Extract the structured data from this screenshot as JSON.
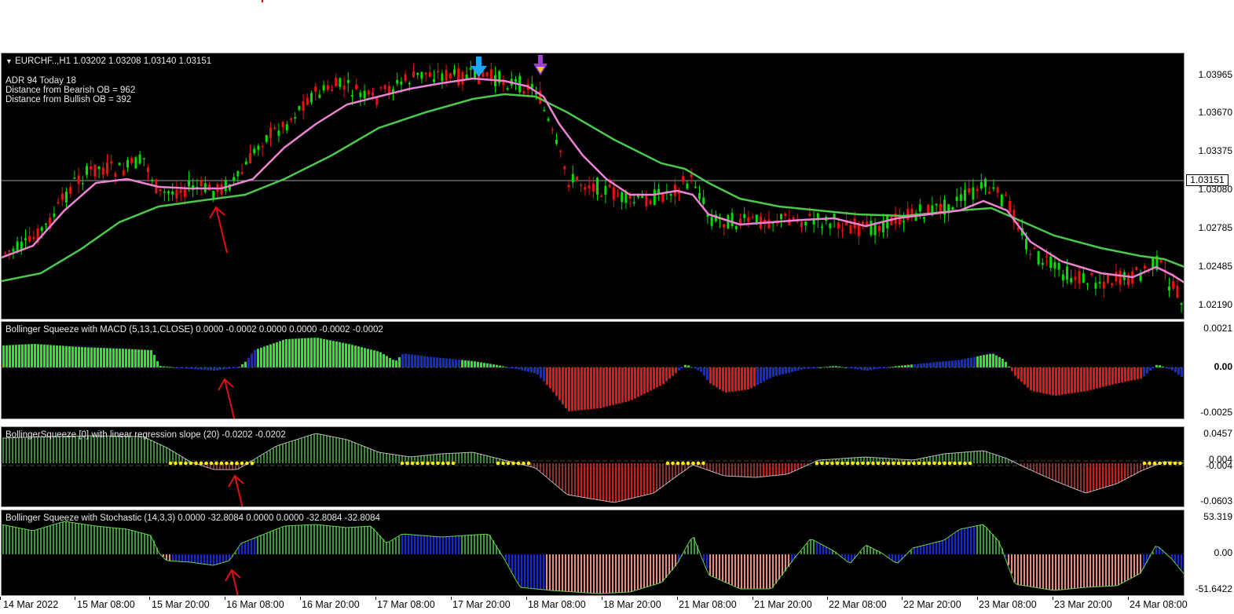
{
  "main": {
    "title": "EURCHF..,H1  1.03202 1.03208 1.03140 1.03151",
    "info": [
      "ADR 94   Today 18",
      "Distance from Bearish OB = 962",
      "Distance from Bullish OB = 392"
    ],
    "current_price": "1.03151",
    "price_labels": [
      "1.03965",
      "1.03670",
      "1.03375",
      "1.03080",
      "1.02785",
      "1.02485",
      "1.02190"
    ]
  },
  "macd": {
    "title": "Bollinger Squeeze with MACD (5,13,1,CLOSE) 0.0000 -0.0002 0.0000 0.0000 -0.0002 -0.0002",
    "labels": [
      "0.0021",
      "0.00",
      "-0.0025"
    ]
  },
  "lrs": {
    "title": "BollingerSqueeze [0] with linear regression slope (20) -0.0202 -0.0202",
    "labels": [
      "0.0457",
      "0.004",
      "-0.004",
      "-0.0603"
    ]
  },
  "stoch": {
    "title": "Bollinger Squeeze with Stochastic (14,3,3) 0.0000 -32.8084 0.0000 0.0000 -32.8084 -32.8084",
    "labels": [
      "53.319",
      "0.00",
      "-51.6422"
    ]
  },
  "time_axis": [
    "14 Mar 2022",
    "15 Mar 08:00",
    "15 Mar 20:00",
    "16 Mar 08:00",
    "16 Mar 20:00",
    "17 Mar 08:00",
    "17 Mar 20:00",
    "18 Mar 08:00",
    "18 Mar 20:00",
    "21 Mar 08:00",
    "21 Mar 20:00",
    "22 Mar 08:00",
    "22 Mar 20:00",
    "23 Mar 08:00",
    "23 Mar 20:00",
    "24 Mar 08:00"
  ],
  "colors": {
    "bull_candle": "#00dd00",
    "bear_candle": "#ee1111",
    "fast_ma": "#ee82d4",
    "slow_ma": "#4cc94c",
    "hist_green": "#22ee22",
    "hist_blue": "#1428e0",
    "hist_red": "#ee1111"
  },
  "icons": [
    "blue-down-arrow-signal-icon",
    "purple-down-arrow-signal-icon",
    "red-annotation-arrow-icon"
  ]
}
